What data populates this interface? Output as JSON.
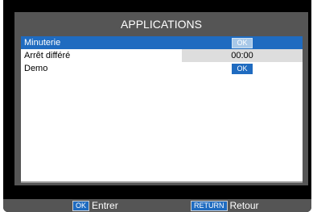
{
  "title": "APPLICATIONS",
  "items": [
    {
      "label": "Minuterie",
      "value": "OK",
      "selected": true
    },
    {
      "label": "Arrêt différé",
      "value": "00:00",
      "selected": false
    },
    {
      "label": "Demo",
      "value": "OK",
      "selected": false
    }
  ],
  "footer": {
    "enter_key": "OK",
    "enter_label": "Entrer",
    "return_key": "RETURN",
    "return_label": "Retour"
  },
  "colors": {
    "accent": "#1f6bc0",
    "panel": "#555555",
    "frame": "#000000"
  }
}
